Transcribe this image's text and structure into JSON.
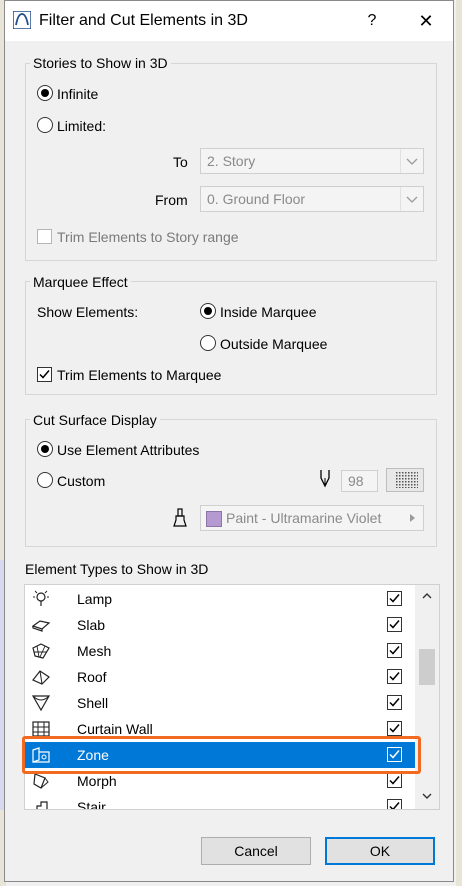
{
  "window": {
    "title": "Filter and Cut Elements in 3D",
    "help_label": "?",
    "close_label": "✕"
  },
  "stories": {
    "legend": "Stories to Show in 3D",
    "infinite_label": "Infinite",
    "limited_label": "Limited:",
    "to_label": "To",
    "to_value": "2. Story",
    "from_label": "From",
    "from_value": "0. Ground Floor",
    "trim_label": "Trim Elements to Story range",
    "selected": "Infinite"
  },
  "marquee": {
    "legend": "Marquee Effect",
    "show_label": "Show Elements:",
    "inside_label": "Inside Marquee",
    "outside_label": "Outside Marquee",
    "trim_label": "Trim Elements to Marquee",
    "trim_checked": true,
    "selected": "Inside Marquee"
  },
  "cut": {
    "legend": "Cut Surface Display",
    "use_attr_label": "Use Element Attributes",
    "custom_label": "Custom",
    "pen_value": "98",
    "paint_value": "Paint - Ultramarine Violet",
    "paint_color": "#b59ad1",
    "selected": "Use Element Attributes"
  },
  "types": {
    "legend": "Element Types to Show in 3D",
    "items": [
      {
        "label": "Lamp",
        "icon": "lamp-icon",
        "checked": true
      },
      {
        "label": "Slab",
        "icon": "slab-icon",
        "checked": true
      },
      {
        "label": "Mesh",
        "icon": "mesh-icon",
        "checked": true
      },
      {
        "label": "Roof",
        "icon": "roof-icon",
        "checked": true
      },
      {
        "label": "Shell",
        "icon": "shell-icon",
        "checked": true
      },
      {
        "label": "Curtain Wall",
        "icon": "curtain-wall-icon",
        "checked": true
      },
      {
        "label": "Zone",
        "icon": "zone-icon",
        "checked": true,
        "selected": true
      },
      {
        "label": "Morph",
        "icon": "morph-icon",
        "checked": true
      },
      {
        "label": "Stair",
        "icon": "stair-icon",
        "checked": true
      }
    ]
  },
  "buttons": {
    "cancel": "Cancel",
    "ok": "OK"
  },
  "colors": {
    "accent": "#0078d7",
    "highlight": "#f26a21"
  }
}
